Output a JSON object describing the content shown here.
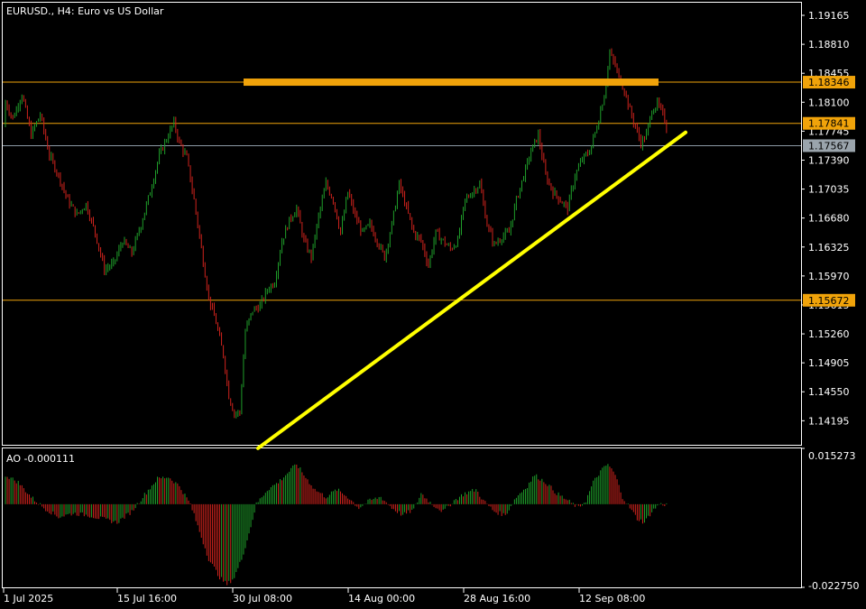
{
  "chart_title": "EURUSD., H4:  Euro vs US Dollar",
  "ao_label": "AO -0.000111",
  "colors": {
    "background": "#000000",
    "frame": "#ffffff",
    "bull": "#1f9e2a",
    "bear": "#d0231d",
    "hline": "#f0a30a",
    "zone": "#f0a30a",
    "trend": "#ffff00",
    "current_price_line": "#8c9aa5",
    "current_price_tag": "#9aa4ac"
  },
  "chart_data": [
    {
      "type": "candlestick",
      "symbol": "EURUSD.",
      "timeframe": "H4",
      "ylim": [
        1.139,
        1.1932
      ],
      "y_ticks": [
        "1.19165",
        "1.18810",
        "1.18455",
        "1.18100",
        "1.17745",
        "1.17390",
        "1.17035",
        "1.16680",
        "1.16325",
        "1.15970",
        "1.15615",
        "1.15260",
        "1.14905",
        "1.14550",
        "1.14195"
      ],
      "x_ticks": [
        "1 Jul 2025",
        "15 Jul 16:00",
        "30 Jul 08:00",
        "14 Aug 00:00",
        "28 Aug 16:00",
        "12 Sep 08:00"
      ],
      "close_path": [
        [
          1,
          1.181
        ],
        [
          5,
          1.179
        ],
        [
          10,
          1.182
        ],
        [
          15,
          1.177
        ],
        [
          20,
          1.1795
        ],
        [
          25,
          1.1745
        ],
        [
          30,
          1.172
        ],
        [
          35,
          1.169
        ],
        [
          40,
          1.1672
        ],
        [
          45,
          1.1685
        ],
        [
          50,
          1.165
        ],
        [
          55,
          1.1605
        ],
        [
          60,
          1.1612
        ],
        [
          65,
          1.164
        ],
        [
          70,
          1.1625
        ],
        [
          75,
          1.166
        ],
        [
          80,
          1.17
        ],
        [
          85,
          1.1745
        ],
        [
          90,
          1.177
        ],
        [
          93,
          1.1785
        ],
        [
          96,
          1.176
        ],
        [
          100,
          1.1742
        ],
        [
          104,
          1.169
        ],
        [
          108,
          1.163
        ],
        [
          112,
          1.157
        ],
        [
          116,
          1.154
        ],
        [
          120,
          1.15
        ],
        [
          123,
          1.145
        ],
        [
          126,
          1.1428
        ],
        [
          129,
          1.143
        ],
        [
          132,
          1.153
        ],
        [
          136,
          1.1555
        ],
        [
          140,
          1.156
        ],
        [
          144,
          1.158
        ],
        [
          148,
          1.159
        ],
        [
          152,
          1.164
        ],
        [
          156,
          1.1665
        ],
        [
          160,
          1.168
        ],
        [
          164,
          1.164
        ],
        [
          168,
          1.162
        ],
        [
          172,
          1.167
        ],
        [
          176,
          1.171
        ],
        [
          180,
          1.169
        ],
        [
          184,
          1.165
        ],
        [
          188,
          1.17
        ],
        [
          192,
          1.167
        ],
        [
          196,
          1.165
        ],
        [
          200,
          1.166
        ],
        [
          204,
          1.164
        ],
        [
          208,
          1.162
        ],
        [
          212,
          1.166
        ],
        [
          216,
          1.171
        ],
        [
          220,
          1.168
        ],
        [
          224,
          1.165
        ],
        [
          228,
          1.164
        ],
        [
          232,
          1.161
        ],
        [
          236,
          1.165
        ],
        [
          240,
          1.164
        ],
        [
          244,
          1.163
        ],
        [
          248,
          1.164
        ],
        [
          252,
          1.169
        ],
        [
          256,
          1.17
        ],
        [
          260,
          1.171
        ],
        [
          264,
          1.166
        ],
        [
          268,
          1.1635
        ],
        [
          272,
          1.1645
        ],
        [
          276,
          1.165
        ],
        [
          280,
          1.169
        ],
        [
          284,
          1.172
        ],
        [
          288,
          1.175
        ],
        [
          292,
          1.177
        ],
        [
          296,
          1.172
        ],
        [
          300,
          1.17
        ],
        [
          304,
          1.169
        ],
        [
          308,
          1.168
        ],
        [
          312,
          1.172
        ],
        [
          316,
          1.174
        ],
        [
          320,
          1.175
        ],
        [
          324,
          1.178
        ],
        [
          328,
          1.182
        ],
        [
          331,
          1.187
        ],
        [
          334,
          1.1855
        ],
        [
          336,
          1.184
        ],
        [
          339,
          1.1825
        ],
        [
          342,
          1.18
        ],
        [
          345,
          1.178
        ],
        [
          348,
          1.176
        ],
        [
          351,
          1.177
        ],
        [
          354,
          1.18
        ],
        [
          357,
          1.1808
        ],
        [
          360,
          1.1795
        ],
        [
          362,
          1.178
        ]
      ],
      "volatility": 0.0009,
      "horizontal_levels": [
        {
          "price": 1.18346,
          "label": "1.18346",
          "style": "level"
        },
        {
          "price": 1.17841,
          "label": "1.17841",
          "style": "level"
        },
        {
          "price": 1.15672,
          "label": "1.15672",
          "style": "level"
        },
        {
          "price": 1.17567,
          "label": "1.17567",
          "style": "current"
        }
      ],
      "resistance_zone": {
        "price": 1.18346
      },
      "trendline": {
        "from": [
          1.14195,
          1.1388
        ],
        "to": [
          1.17841,
          1.1768
        ]
      }
    },
    {
      "type": "bar",
      "indicator": "AO",
      "ylim": [
        -0.02275,
        0.015273
      ],
      "y_ticks": [
        "0.015273",
        "-0.022750"
      ],
      "value_path": [
        [
          1,
          0.008
        ],
        [
          8,
          0.006
        ],
        [
          15,
          0.002
        ],
        [
          22,
          -0.001
        ],
        [
          30,
          -0.0035
        ],
        [
          38,
          -0.0025
        ],
        [
          46,
          -0.003
        ],
        [
          54,
          -0.004
        ],
        [
          62,
          -0.005
        ],
        [
          70,
          -0.002
        ],
        [
          76,
          0.002
        ],
        [
          84,
          0.007
        ],
        [
          90,
          0.0075
        ],
        [
          96,
          0.005
        ],
        [
          102,
          0.0
        ],
        [
          106,
          -0.006
        ],
        [
          112,
          -0.015
        ],
        [
          118,
          -0.02
        ],
        [
          122,
          -0.022
        ],
        [
          126,
          -0.02
        ],
        [
          130,
          -0.015
        ],
        [
          134,
          -0.008
        ],
        [
          138,
          0.0
        ],
        [
          144,
          0.004
        ],
        [
          150,
          0.006
        ],
        [
          156,
          0.009
        ],
        [
          160,
          0.011
        ],
        [
          164,
          0.008
        ],
        [
          170,
          0.004
        ],
        [
          176,
          0.002
        ],
        [
          182,
          0.004
        ],
        [
          188,
          0.002
        ],
        [
          194,
          -0.001
        ],
        [
          200,
          0.001
        ],
        [
          206,
          0.002
        ],
        [
          212,
          -0.001
        ],
        [
          218,
          -0.003
        ],
        [
          224,
          -0.0015
        ],
        [
          228,
          0.003
        ],
        [
          234,
          0.0
        ],
        [
          240,
          -0.002
        ],
        [
          246,
          0.001
        ],
        [
          252,
          0.003
        ],
        [
          258,
          0.004
        ],
        [
          262,
          0.001
        ],
        [
          268,
          -0.002
        ],
        [
          274,
          -0.003
        ],
        [
          280,
          0.002
        ],
        [
          286,
          0.005
        ],
        [
          290,
          0.008
        ],
        [
          296,
          0.006
        ],
        [
          302,
          0.003
        ],
        [
          308,
          0.001
        ],
        [
          314,
          -0.001
        ],
        [
          318,
          0.001
        ],
        [
          322,
          0.006
        ],
        [
          326,
          0.009
        ],
        [
          330,
          0.011
        ],
        [
          334,
          0.008
        ],
        [
          338,
          0.002
        ],
        [
          342,
          -0.001
        ],
        [
          346,
          -0.004
        ],
        [
          350,
          -0.005
        ],
        [
          354,
          -0.002
        ],
        [
          358,
          0.0
        ],
        [
          362,
          -0.0001
        ]
      ]
    }
  ]
}
